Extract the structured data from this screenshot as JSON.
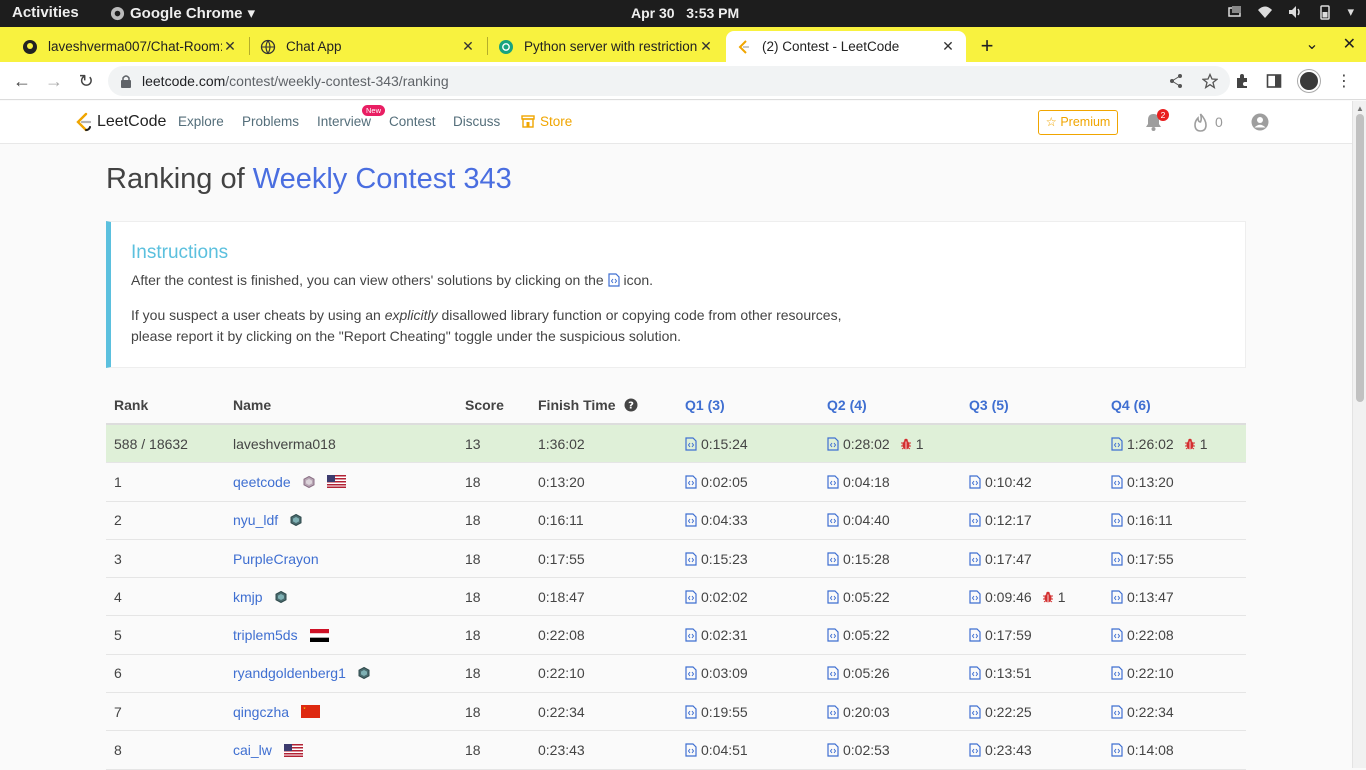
{
  "system": {
    "activities": "Activities",
    "app_name": "Google Chrome",
    "clock_date": "Apr 30",
    "clock_time": "3:53 PM"
  },
  "tabs": [
    {
      "title": "laveshverma007/Chat-Room:",
      "icon": "github-icon"
    },
    {
      "title": "Chat App",
      "icon": "globe-icon"
    },
    {
      "title": "Python server with restriction",
      "icon": "openai-icon"
    },
    {
      "title": "(2) Contest - LeetCode",
      "icon": "leetcode-icon",
      "active": true
    }
  ],
  "address_bar": {
    "domain": "leetcode.com",
    "path": "/contest/weekly-contest-343/ranking"
  },
  "leetcode_nav": {
    "logo_text": "LeetCode",
    "links": [
      "Explore",
      "Problems",
      "Interview",
      "Contest",
      "Discuss"
    ],
    "new_badge": "New",
    "store": "Store",
    "premium": "Premium",
    "notification_count": "2",
    "streak_count": "0"
  },
  "page": {
    "title_prefix": "Ranking of",
    "contest_name": "Weekly Contest 343"
  },
  "instructions": {
    "title": "Instructions",
    "line1_before": "After the contest is finished, you can view others' solutions by clicking on the",
    "line1_after": "icon.",
    "line2_before": "If you suspect a user cheats by using an",
    "line2_em": "explicitly",
    "line2_after": "disallowed library function or copying code from other resources,",
    "line3": "please report it by clicking on the \"Report Cheating\" toggle under the suspicious solution."
  },
  "table": {
    "headers": {
      "rank": "Rank",
      "name": "Name",
      "score": "Score",
      "finish_time": "Finish Time",
      "q1": "Q1 (3)",
      "q2": "Q2 (4)",
      "q3": "Q3 (5)",
      "q4": "Q4 (6)"
    },
    "rows": [
      {
        "rank": "588 / 18632",
        "name": "laveshverma018",
        "score": "13",
        "finish": "1:36:02",
        "q1": "0:15:24",
        "q1_bug": "",
        "q2": "0:28:02",
        "q2_bug": "1",
        "q3": "",
        "q3_bug": "",
        "q4": "1:26:02",
        "q4_bug": "1",
        "badge": "",
        "flag": "",
        "mine": true
      },
      {
        "rank": "1",
        "name": "qeetcode",
        "score": "18",
        "finish": "0:13:20",
        "q1": "0:02:05",
        "q1_bug": "",
        "q2": "0:04:18",
        "q2_bug": "",
        "q3": "0:10:42",
        "q3_bug": "",
        "q4": "0:13:20",
        "q4_bug": "",
        "badge": "guardian",
        "flag": "us"
      },
      {
        "rank": "2",
        "name": "nyu_ldf",
        "score": "18",
        "finish": "0:16:11",
        "q1": "0:04:33",
        "q1_bug": "",
        "q2": "0:04:40",
        "q2_bug": "",
        "q3": "0:12:17",
        "q3_bug": "",
        "q4": "0:16:11",
        "q4_bug": "",
        "badge": "knight",
        "flag": ""
      },
      {
        "rank": "3",
        "name": "PurpleCrayon",
        "score": "18",
        "finish": "0:17:55",
        "q1": "0:15:23",
        "q1_bug": "",
        "q2": "0:15:28",
        "q2_bug": "",
        "q3": "0:17:47",
        "q3_bug": "",
        "q4": "0:17:55",
        "q4_bug": "",
        "badge": "",
        "flag": ""
      },
      {
        "rank": "4",
        "name": "kmjp",
        "score": "18",
        "finish": "0:18:47",
        "q1": "0:02:02",
        "q1_bug": "",
        "q2": "0:05:22",
        "q2_bug": "",
        "q3": "0:09:46",
        "q3_bug": "1",
        "q4": "0:13:47",
        "q4_bug": "",
        "badge": "knight",
        "flag": ""
      },
      {
        "rank": "5",
        "name": "triplem5ds",
        "score": "18",
        "finish": "0:22:08",
        "q1": "0:02:31",
        "q1_bug": "",
        "q2": "0:05:22",
        "q2_bug": "",
        "q3": "0:17:59",
        "q3_bug": "",
        "q4": "0:22:08",
        "q4_bug": "",
        "badge": "",
        "flag": "eg"
      },
      {
        "rank": "6",
        "name": "ryandgoldenberg1",
        "score": "18",
        "finish": "0:22:10",
        "q1": "0:03:09",
        "q1_bug": "",
        "q2": "0:05:26",
        "q2_bug": "",
        "q3": "0:13:51",
        "q3_bug": "",
        "q4": "0:22:10",
        "q4_bug": "",
        "badge": "knight",
        "flag": ""
      },
      {
        "rank": "7",
        "name": "qingczha",
        "score": "18",
        "finish": "0:22:34",
        "q1": "0:19:55",
        "q1_bug": "",
        "q2": "0:20:03",
        "q2_bug": "",
        "q3": "0:22:25",
        "q3_bug": "",
        "q4": "0:22:34",
        "q4_bug": "",
        "badge": "",
        "flag": "cn"
      },
      {
        "rank": "8",
        "name": "cai_lw",
        "score": "18",
        "finish": "0:23:43",
        "q1": "0:04:51",
        "q1_bug": "",
        "q2": "0:02:53",
        "q2_bug": "",
        "q3": "0:23:43",
        "q3_bug": "",
        "q4": "0:14:08",
        "q4_bug": "",
        "badge": "",
        "flag": "us"
      }
    ]
  },
  "colors": {
    "tab_bar": "#f8f23f",
    "link_blue": "#3f6fd1",
    "own_row": "#dff0d8",
    "instructions_accent": "#5bc0de",
    "premium": "#f0a500",
    "bug_red": "#d32f2f"
  }
}
